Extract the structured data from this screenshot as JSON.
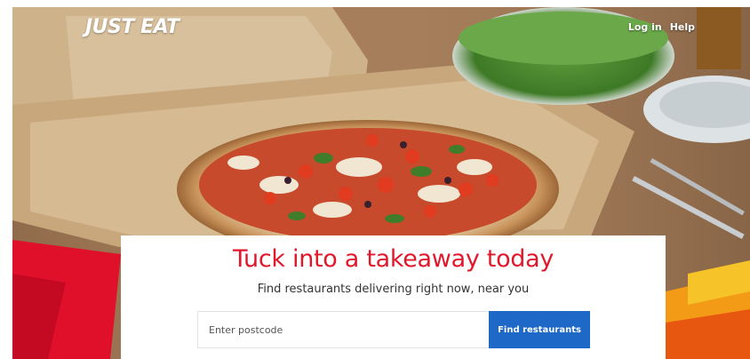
{
  "brand": {
    "logo_text": "JUST EAT",
    "accent_color": "#e0182b",
    "button_color": "#1e69c7"
  },
  "nav": {
    "login_label": "Log in",
    "help_label": "Help"
  },
  "hero": {
    "image_icon": "pizza-photo"
  },
  "search": {
    "headline": "Tuck into a takeaway today",
    "subline": "Find restaurants delivering right now, near you",
    "postcode_placeholder": "Enter postcode",
    "postcode_value": "",
    "button_label": "Find restaurants"
  }
}
